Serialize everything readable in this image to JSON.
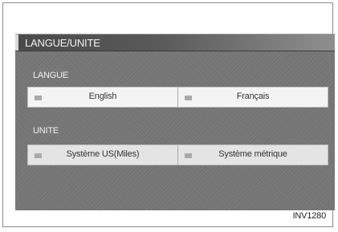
{
  "screen": {
    "title": "LANGUE/UNITE",
    "sections": [
      {
        "label": "LANGUE",
        "options": [
          {
            "label": "English",
            "marker_icon": "square-marker"
          },
          {
            "label": "Français",
            "marker_icon": "square-marker"
          }
        ]
      },
      {
        "label": "UNITE",
        "options": [
          {
            "label": "Système US(Miles)",
            "marker_icon": "square-marker"
          },
          {
            "label": "Système métrique",
            "marker_icon": "square-marker"
          }
        ]
      }
    ]
  },
  "figure_ref": "INV1280",
  "colors": {
    "screen_bg": "#767676",
    "title_bar": "#4a4a4a",
    "button_bg": "#f4f4f4",
    "text_light": "#f0f0f0",
    "text_dark": "#333333"
  }
}
